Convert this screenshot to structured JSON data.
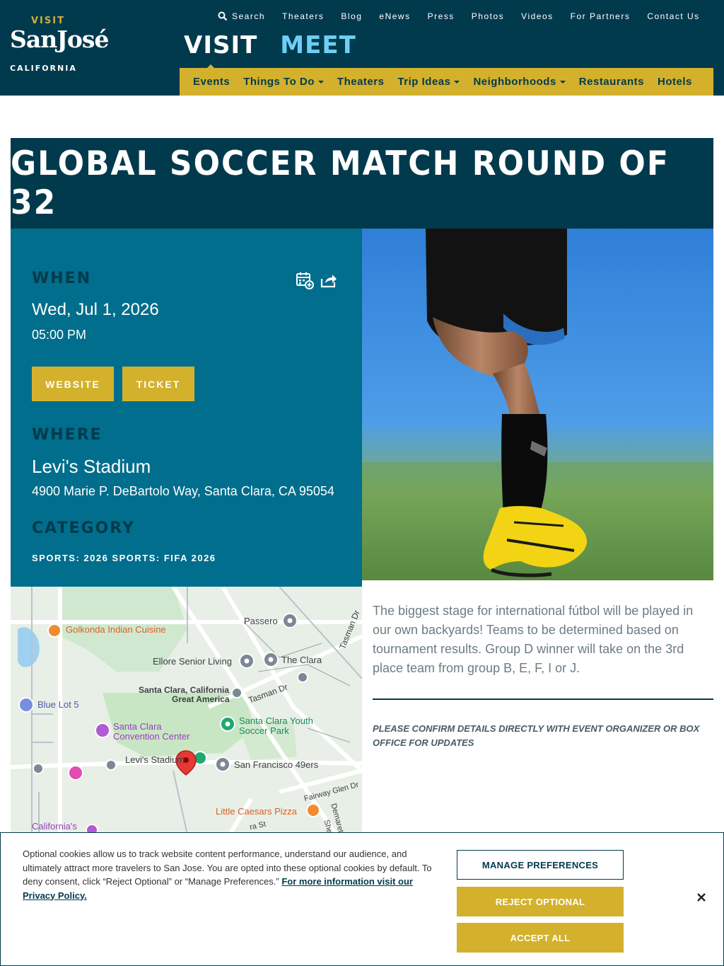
{
  "header": {
    "logo": {
      "top": "VISIT",
      "main": "SanJosé",
      "bottom": "CALIFORNIA"
    },
    "utility_nav": {
      "search": "Search",
      "items": [
        "Theaters",
        "Blog",
        "eNews",
        "Press",
        "Photos",
        "Videos",
        "For Partners",
        "Contact Us"
      ]
    },
    "big_tabs": {
      "visit": "VISIT",
      "meet": "MEET"
    },
    "main_nav": [
      {
        "label": "Events",
        "dropdown": false
      },
      {
        "label": "Things To Do",
        "dropdown": true
      },
      {
        "label": "Theaters",
        "dropdown": false
      },
      {
        "label": "Trip Ideas",
        "dropdown": true
      },
      {
        "label": "Neighborhoods",
        "dropdown": true
      },
      {
        "label": "Restaurants",
        "dropdown": false
      },
      {
        "label": "Hotels",
        "dropdown": false
      }
    ]
  },
  "event": {
    "title": "Global Soccer Match Round of 32",
    "when_label": "When",
    "date": "Wed, Jul 1, 2026",
    "time": "05:00 PM",
    "website_label": "Website",
    "ticket_label": "Ticket",
    "where_label": "Where",
    "venue": "Levi's Stadium",
    "address": "4900 Marie P. DeBartolo Way, Santa Clara, CA 95054",
    "category_label": "Category",
    "categories": "Sports: 2026 Sports: FIFA 2026",
    "description": "The biggest stage for international fútbol will be played in our own backyards! Teams to be determined based on tournament results. Group D winner will take on the 3rd place team from group B, E, F, I or J.",
    "note": "Please confirm details directly with event organizer or box office for updates"
  },
  "map": {
    "labels": {
      "golkonda": "Golkonda Indian Cuisine",
      "passero": "Passero",
      "ellore": "Ellore Senior Living",
      "clara": "The Clara",
      "santa_clara_1": "Santa Clara, California",
      "santa_clara_2": "Great America",
      "tasman": "Tasman Dr",
      "tasman_dr2": "Tasman Dr",
      "blue_lot": "Blue Lot 5",
      "convention_1": "Santa Clara",
      "convention_2": "Convention Center",
      "youth_1": "Santa Clara Youth",
      "youth_2": "Soccer Park",
      "levis": "Levi's Stadium",
      "niners": "San Francisco 49ers",
      "fairway": "Fairway Glen Dr",
      "little_caesars": "Little Caesars Pizza",
      "californias": "California's",
      "demaret": "Demaret",
      "ma_st": "ra St",
      "she": "She"
    }
  },
  "cookie": {
    "text": "Optional cookies allow us to track website content performance, understand our audience, and ultimately attract more travelers to San Jose. You are opted into these optional cookies by default. To deny consent, click “Reject Optional” or “Manage Preferences.”",
    "link": "For more information visit our Privacy Policy.",
    "manage": "Manage Preferences",
    "reject": "Reject Optional",
    "accept": "Accept All"
  },
  "colors": {
    "navy": "#023a4d",
    "teal": "#006e8c",
    "gold": "#d3b12c",
    "light_blue": "#6dcff6"
  }
}
